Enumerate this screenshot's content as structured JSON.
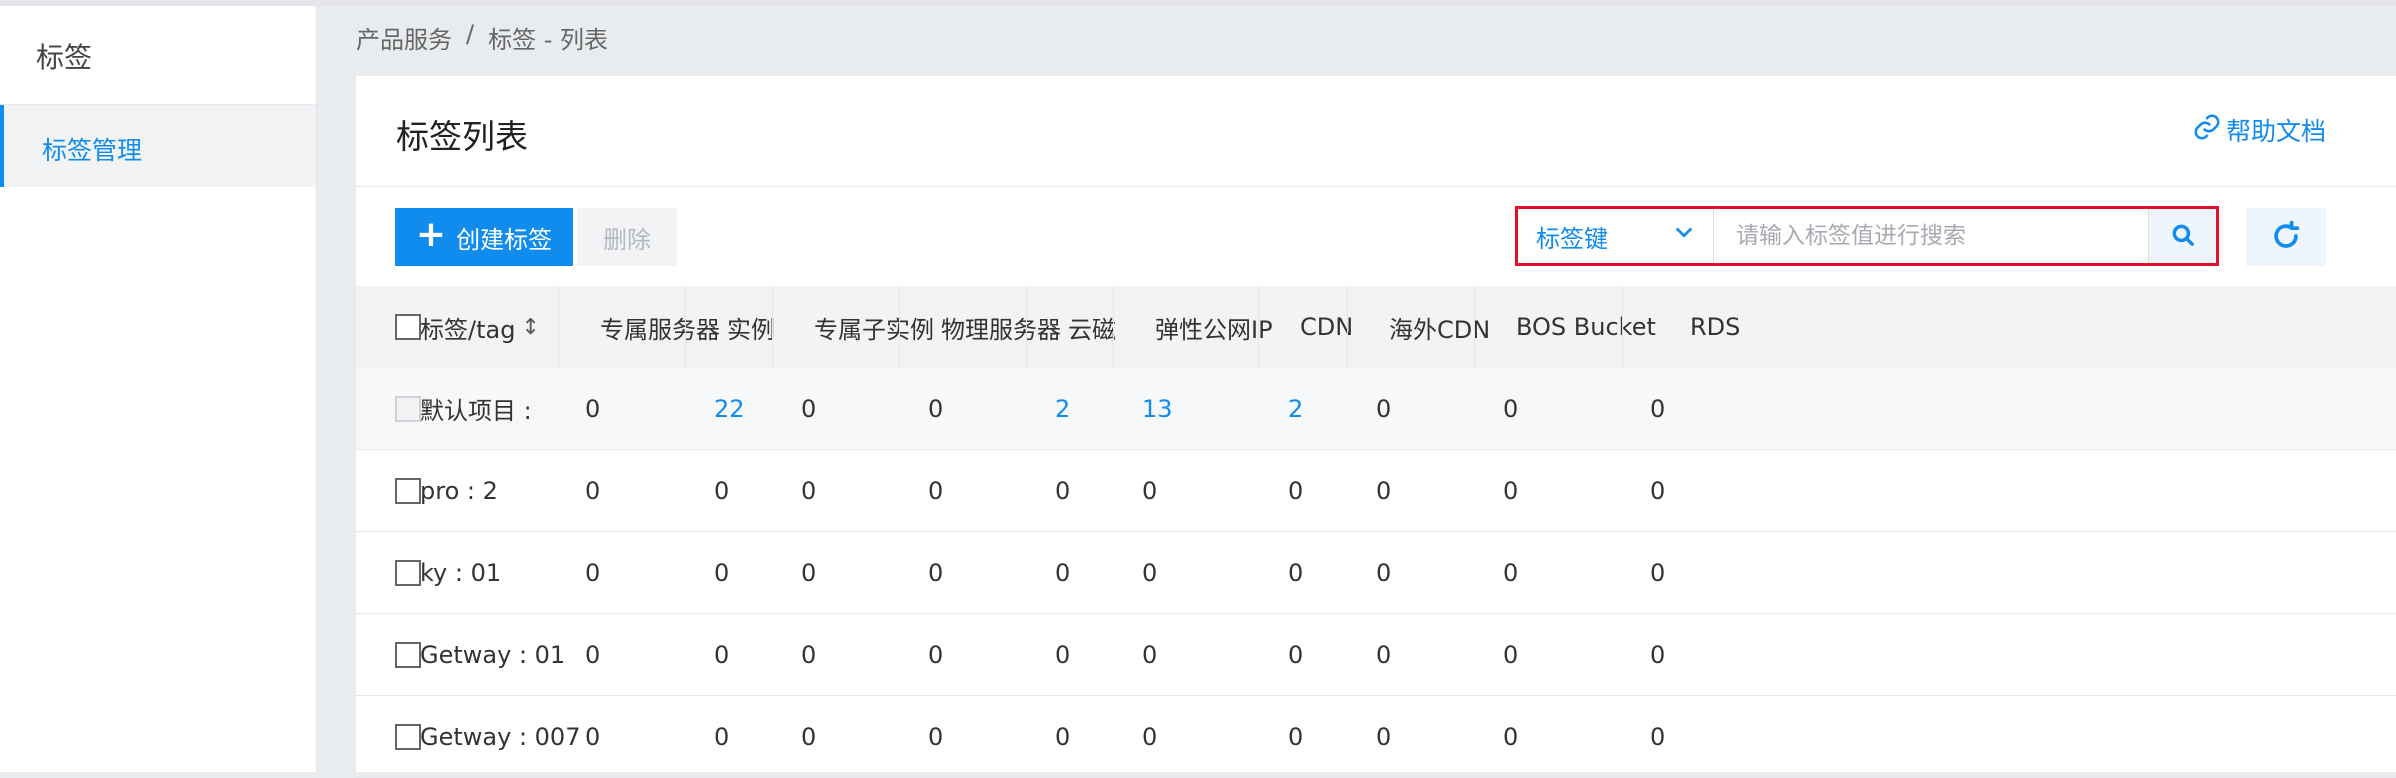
{
  "sidebar": {
    "title": "标签",
    "items": [
      {
        "label": "标签管理",
        "active": true
      }
    ]
  },
  "breadcrumb": {
    "items": [
      "产品服务",
      "标签 - 列表"
    ],
    "separator": "/"
  },
  "page": {
    "title": "标签列表",
    "help_label": "帮助文档"
  },
  "toolbar": {
    "create_label": "创建标签",
    "delete_label": "删除",
    "search": {
      "select_value": "标签键",
      "placeholder": "请输入标签值进行搜索"
    }
  },
  "table": {
    "columns": [
      "标签/tag",
      "专属服务器",
      "实例",
      "专属子实例",
      "物理服务器",
      "云磁",
      "弹性公网IP",
      "CDN",
      "海外CDN",
      "BOS Bucket",
      "RDS"
    ],
    "rows": [
      {
        "tag": "默认项目 :",
        "values": [
          "0",
          "22",
          "0",
          "0",
          "2",
          "13",
          "2",
          "0",
          "0",
          "0"
        ],
        "links": [
          false,
          true,
          false,
          false,
          true,
          true,
          true,
          false,
          false,
          false
        ],
        "checkbox_disabled": true
      },
      {
        "tag": "pro : 2",
        "values": [
          "0",
          "0",
          "0",
          "0",
          "0",
          "0",
          "0",
          "0",
          "0",
          "0"
        ],
        "links": [
          false,
          false,
          false,
          false,
          false,
          false,
          false,
          false,
          false,
          false
        ],
        "checkbox_disabled": false
      },
      {
        "tag": "ky : 01",
        "values": [
          "0",
          "0",
          "0",
          "0",
          "0",
          "0",
          "0",
          "0",
          "0",
          "0"
        ],
        "links": [
          false,
          false,
          false,
          false,
          false,
          false,
          false,
          false,
          false,
          false
        ],
        "checkbox_disabled": false
      },
      {
        "tag": "Getway : 01",
        "values": [
          "0",
          "0",
          "0",
          "0",
          "0",
          "0",
          "0",
          "0",
          "0",
          "0"
        ],
        "links": [
          false,
          false,
          false,
          false,
          false,
          false,
          false,
          false,
          false,
          false
        ],
        "checkbox_disabled": false
      },
      {
        "tag": "Getway : 007",
        "values": [
          "0",
          "0",
          "0",
          "0",
          "0",
          "0",
          "0",
          "0",
          "0",
          "0"
        ],
        "links": [
          false,
          false,
          false,
          false,
          false,
          false,
          false,
          false,
          false,
          false
        ],
        "checkbox_disabled": false
      }
    ]
  },
  "colors": {
    "accent": "#108cee",
    "highlight_border": "#e3102b"
  },
  "icons": [
    "plus-icon",
    "chevron-down-icon",
    "search-icon",
    "refresh-icon",
    "link-icon",
    "sort-icon"
  ]
}
